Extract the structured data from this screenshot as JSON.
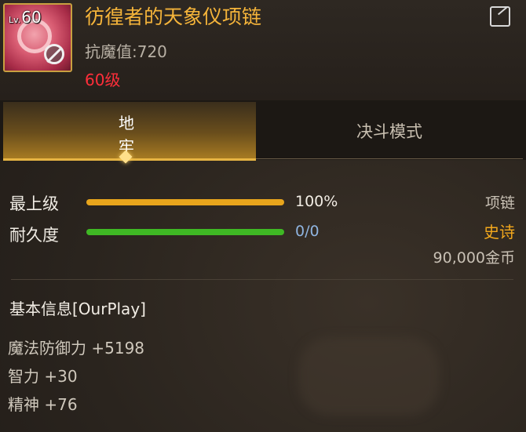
{
  "item": {
    "level_prefix": "Lv.",
    "level": "60",
    "name": "彷徨者的天象仪项链",
    "resist": "抗魔值:720",
    "required_level": "60级",
    "name_color": "#f5b43a",
    "required_level_color": "#ff2e3a",
    "icon": "necklace-icon",
    "restricted_icon": "no-trade-icon",
    "share_icon": "share-icon"
  },
  "tabs": [
    {
      "label": "地牢",
      "active": true
    },
    {
      "label": "决斗模式",
      "active": false
    }
  ],
  "stats": {
    "max_level_label": "最上级",
    "max_level_value": "100%",
    "max_level_fraction": 1.0,
    "durability_label": "耐久度",
    "durability_value": "0/0",
    "durability_fraction": 1.0,
    "bar_colors": {
      "max_level": "#e8a51c",
      "durability": "#3fb824"
    }
  },
  "meta": {
    "type": "项链",
    "grade": "史诗",
    "grade_color": "#f3a81c",
    "price": "90,000金币"
  },
  "basic_info": {
    "title": "基本信息[OurPlay]",
    "attributes": [
      "魔法防御力 +5198",
      "智力 +30",
      "精神 +76"
    ]
  }
}
